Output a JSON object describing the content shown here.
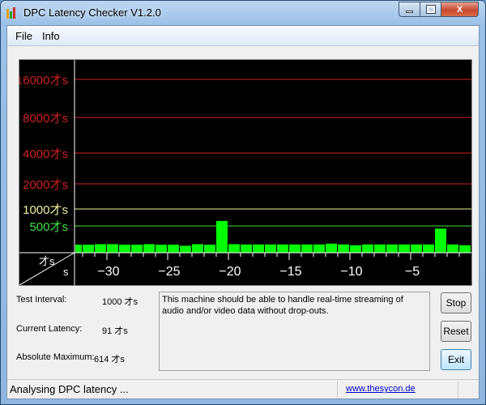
{
  "window": {
    "title": "DPC Latency Checker V1.2.0",
    "minimize": "minimize",
    "maximize": "maximize",
    "close": "X"
  },
  "menu": {
    "items": [
      {
        "label": "File"
      },
      {
        "label": "Info"
      }
    ]
  },
  "chart_data": {
    "type": "bar",
    "y_scale": "log-like (custom ticks)",
    "y_ticks": [
      {
        "value": 500,
        "label": "500才s",
        "color": "#40e040"
      },
      {
        "value": 1000,
        "label": "1000才s",
        "color": "#f0f0a0"
      },
      {
        "value": 2000,
        "label": "2000才s",
        "color": "#d02020"
      },
      {
        "value": 4000,
        "label": "4000才s",
        "color": "#d02020"
      },
      {
        "value": 8000,
        "label": "8000才s",
        "color": "#d02020"
      },
      {
        "value": 16000,
        "label": "16000才s",
        "color": "#d02020"
      }
    ],
    "x_ticks": [
      -30,
      -25,
      -20,
      -15,
      -10,
      -5
    ],
    "x_tick_labels": [
      "−30",
      "−25",
      "−20",
      "−15",
      "−10",
      "−5"
    ],
    "xlim": [
      -32.67,
      0
    ],
    "corner_y_unit": "才s",
    "corner_x_unit": "s",
    "x": [
      -33,
      -32,
      -31,
      -30,
      -29,
      -28,
      -27,
      -26,
      -25,
      -24,
      -23,
      -22,
      -21,
      -20,
      -19,
      -18,
      -17,
      -16,
      -15,
      -14,
      -13,
      -12,
      -11,
      -10,
      -9,
      -8,
      -7,
      -6,
      -5,
      -4,
      -3,
      -2,
      -1
    ],
    "values": [
      150,
      150,
      160,
      160,
      150,
      150,
      160,
      150,
      150,
      130,
      160,
      150,
      614,
      160,
      155,
      155,
      155,
      155,
      155,
      155,
      155,
      170,
      155,
      140,
      155,
      155,
      155,
      155,
      155,
      155,
      450,
      155,
      140
    ],
    "bar_color": "#00ff00",
    "grid": true
  },
  "stats": {
    "test_interval_label": "Test Interval:",
    "test_interval_value": "1000 才s",
    "current_latency_label": "Current Latency:",
    "current_latency_value": "91 才s",
    "absolute_max_label": "Absolute Maximum:",
    "absolute_max_value": "614 才s"
  },
  "message": "This machine should be able to handle real-time streaming of audio and/or video data without drop-outs.",
  "buttons": {
    "stop": "Stop",
    "reset": "Reset",
    "exit": "Exit"
  },
  "status": {
    "text": "Analysing DPC latency ...",
    "link": "www.thesycon.de"
  }
}
